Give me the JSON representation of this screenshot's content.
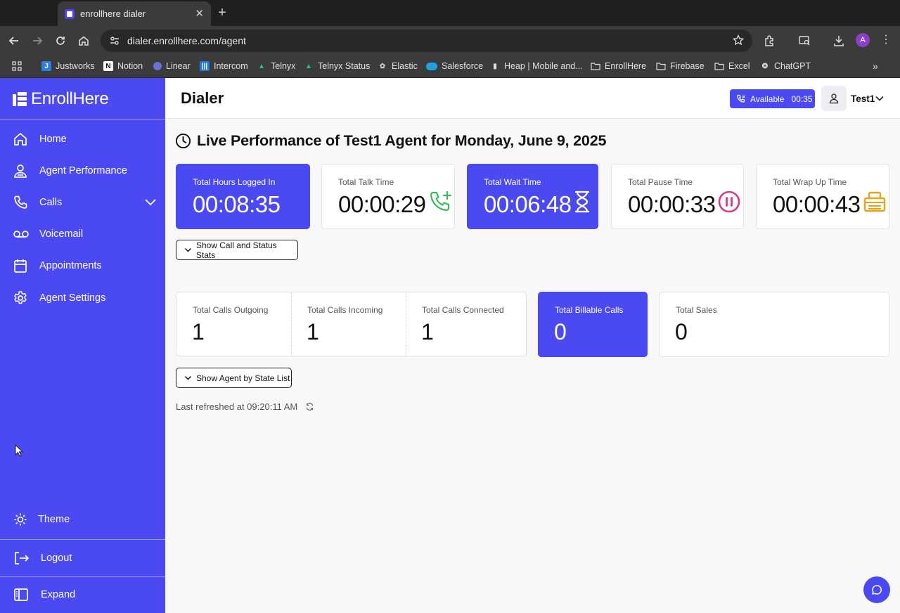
{
  "browser": {
    "tab_title": "enrollhere dialer",
    "new_tab": "+",
    "url": "dialer.enrollhere.com/agent",
    "profile_initial": "A",
    "bookmarks": [
      {
        "label": "Justworks"
      },
      {
        "label": "Notion"
      },
      {
        "label": "Linear"
      },
      {
        "label": "Intercom"
      },
      {
        "label": "Telnyx"
      },
      {
        "label": "Telnyx Status"
      },
      {
        "label": "Elastic"
      },
      {
        "label": "Salesforce"
      },
      {
        "label": "Heap | Mobile and..."
      },
      {
        "label": "EnrollHere"
      },
      {
        "label": "Firebase"
      },
      {
        "label": "Excel"
      },
      {
        "label": "ChatGPT"
      }
    ]
  },
  "sidebar": {
    "brand": "EnrollHere",
    "items": [
      {
        "label": "Home",
        "icon": "home-icon"
      },
      {
        "label": "Agent Performance",
        "icon": "agent-performance-icon"
      },
      {
        "label": "Calls",
        "icon": "phone-icon"
      },
      {
        "label": "Voicemail",
        "icon": "voicemail-icon"
      },
      {
        "label": "Appointments",
        "icon": "calendar-icon"
      },
      {
        "label": "Agent Settings",
        "icon": "gear-icon"
      }
    ],
    "theme_label": "Theme",
    "logout_label": "Logout",
    "expand_label": "Expand"
  },
  "header": {
    "title": "Dialer",
    "status_label": "Available",
    "status_timer": "00:35",
    "user_name": "Test1"
  },
  "performance": {
    "heading": "Live Performance of Test1 Agent for Monday, June 9, 2025",
    "stats": [
      {
        "label": "Total Hours Logged In",
        "value": "00:08:35"
      },
      {
        "label": "Total Talk Time",
        "value": "00:00:29"
      },
      {
        "label": "Total Wait Time",
        "value": "00:06:48"
      },
      {
        "label": "Total Pause Time",
        "value": "00:00:33"
      },
      {
        "label": "Total Wrap Up Time",
        "value": "00:00:43"
      }
    ],
    "show_call_stats_label": "Show Call and Status Stats",
    "calls": [
      {
        "label": "Total Calls Outgoing",
        "value": "1"
      },
      {
        "label": "Total Calls Incoming",
        "value": "1"
      },
      {
        "label": "Total Calls Connected",
        "value": "1"
      },
      {
        "label": "Total Billable Calls",
        "value": "0"
      },
      {
        "label": "Total Sales",
        "value": "0"
      }
    ],
    "show_agent_state_label": "Show Agent by State List",
    "last_refreshed": "Last refreshed at 09:20:11 AM"
  },
  "colors": {
    "brand": "#4b4af2",
    "talk_icon": "#3cb95a",
    "pause_icon": "#d23c8c",
    "wrap_icon": "#e9a21a"
  }
}
